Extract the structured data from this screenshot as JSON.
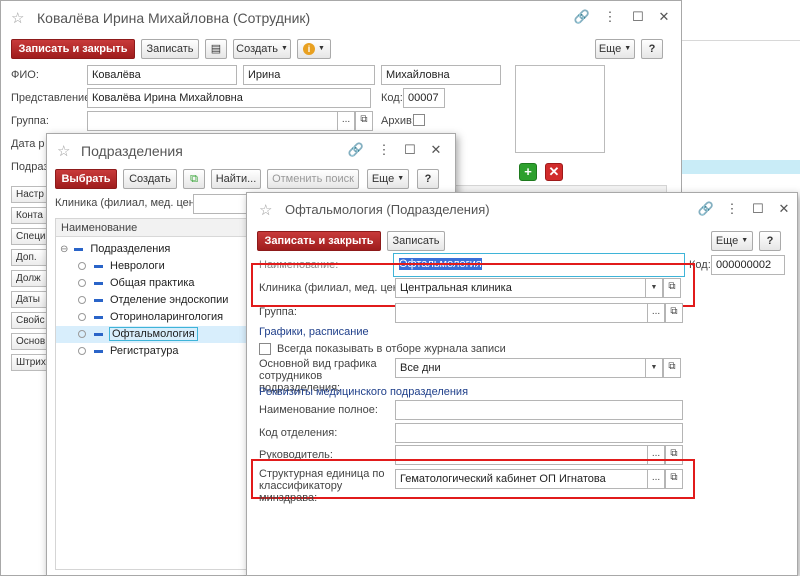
{
  "employee": {
    "title": "Ковалёва Ирина Михайловна (Сотрудник)",
    "toolbar": {
      "save_close": "Записать и закрыть",
      "save": "Записать",
      "create": "Создать",
      "more": "Еще",
      "help": "?"
    },
    "fio_label": "ФИО:",
    "last_name": "Ковалёва",
    "first_name": "Ирина",
    "middle_name": "Михайловна",
    "repr_label": "Представление:",
    "repr_value": "Ковалёва Ирина Михайловна",
    "code_label": "Код:",
    "code_value": "00007",
    "group_label": "Группа:",
    "archive_label": "Архив:",
    "date_label": "Дата р",
    "subdiv_label": "Подраз",
    "tabs": [
      "Настр",
      "Конта",
      "Специ",
      "Доп.",
      "Долж",
      "Даты",
      "Свойс",
      "Основ",
      "Штрих"
    ]
  },
  "subdivisions": {
    "title": "Подразделения",
    "toolbar": {
      "choose": "Выбрать",
      "create": "Создать",
      "find": "Найти...",
      "cancel_search": "Отменить поиск",
      "more": "Еще",
      "help": "?"
    },
    "filter_label": "Клиника (филиал, мед. центр):",
    "column_header": "Наименование",
    "root": "Подразделения",
    "items": [
      "Неврологи",
      "Общая практика",
      "Отделение эндоскопии",
      "Оториноларингология",
      "Офтальмология",
      "Регистратура"
    ],
    "selected_index": 4
  },
  "ophthalmology": {
    "title": "Офтальмология (Подразделения)",
    "toolbar": {
      "save_close": "Записать и закрыть",
      "save": "Записать",
      "more": "Еще",
      "help": "?"
    },
    "name_label": "Наименование:",
    "name_value": "Офтальмология",
    "code_label": "Код:",
    "code_value": "000000002",
    "clinic_label": "Клиника (филиал, мед. центр):",
    "clinic_value": "Центральная клиника",
    "group_label": "Группа:",
    "schedules_header": "Графики, расписание",
    "always_show_label": "Всегда показывать в отборе журнала записи",
    "schedule_type_label": "Основной вид графика сотрудников подразделения:",
    "schedule_type_value": "Все дни",
    "requisites_header": "Реквизиты медицинского подразделения",
    "full_name_label": "Наименование полное:",
    "dept_code_label": "Код отделения:",
    "head_label": "Руководитель:",
    "struct_unit_label": "Структурная единица по классификатору минздрава:",
    "struct_unit_value": "Гематологический кабинет ОП Игнатова"
  }
}
